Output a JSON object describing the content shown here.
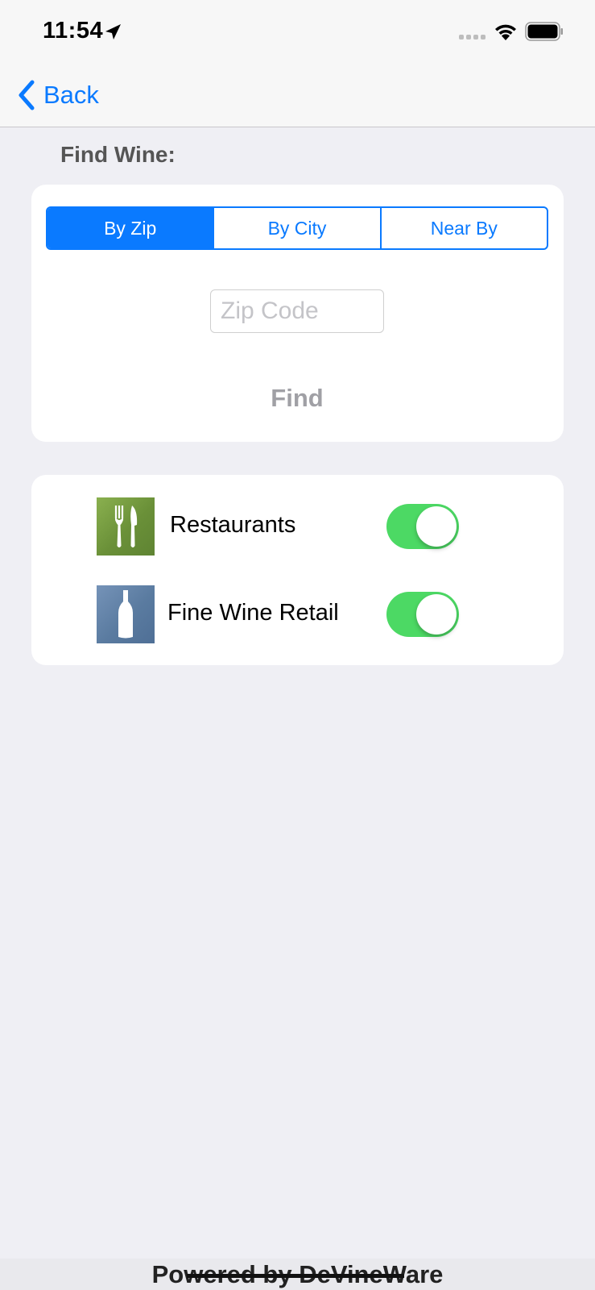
{
  "status_bar": {
    "time": "11:54"
  },
  "nav": {
    "back_label": "Back"
  },
  "search": {
    "title": "Find Wine:",
    "tabs": [
      {
        "label": "By Zip",
        "selected": true
      },
      {
        "label": "By City",
        "selected": false
      },
      {
        "label": "Near By",
        "selected": false
      }
    ],
    "zip_placeholder": "Zip Code",
    "zip_value": "",
    "find_label": "Find"
  },
  "filters": [
    {
      "label": "Restaurants",
      "icon": "fork-knife-icon",
      "enabled": true
    },
    {
      "label": "Fine Wine Retail",
      "icon": "wine-bottle-icon",
      "enabled": true
    }
  ],
  "footer": {
    "text": "Powered by DeVineWare"
  },
  "colors": {
    "accent": "#0a7aff",
    "toggle_on": "#4cd964",
    "background": "#efeff4",
    "restaurant_icon": "#6a9038",
    "retail_icon": "#5a7ba0"
  }
}
